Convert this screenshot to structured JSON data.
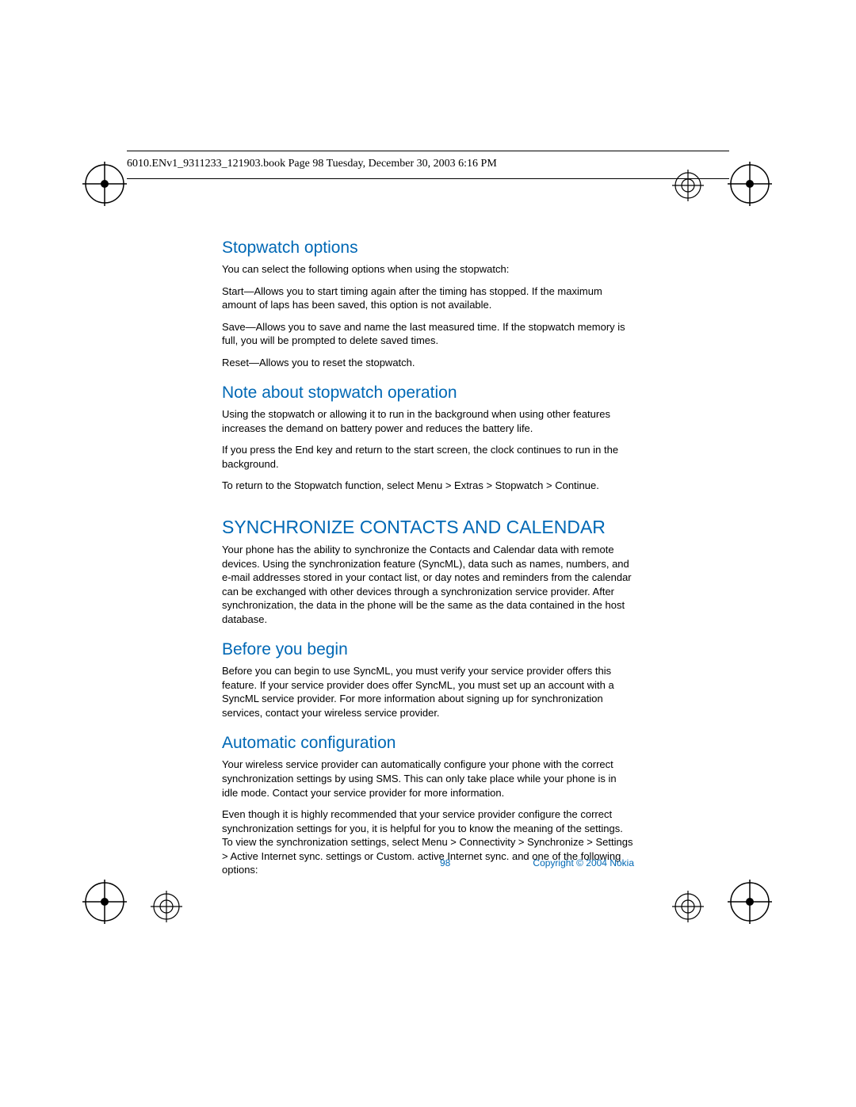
{
  "header": {
    "line": "6010.ENv1_9311233_121903.book  Page 98  Tuesday, December 30, 2003  6:16 PM"
  },
  "sections": {
    "stopwatch_options": {
      "title": "Stopwatch options",
      "intro": "You can select the following options when using the stopwatch:",
      "start": "Start—Allows you to start timing again after the timing has stopped. If the maximum amount of laps has been saved, this option is not available.",
      "save": "Save—Allows you to save and name the last measured time. If the stopwatch memory is full, you will be prompted to delete saved times.",
      "reset": "Reset—Allows you to reset the stopwatch."
    },
    "note": {
      "title": "Note about stopwatch operation",
      "p1": "Using the stopwatch or allowing it to run in the background when using other features increases the demand on battery power and reduces the battery life.",
      "p2": "If you press the End key and return to the start screen, the clock continues to run in the background.",
      "p3": "To return to the Stopwatch function, select Menu > Extras > Stopwatch > Continue."
    },
    "sync": {
      "title": "SYNCHRONIZE CONTACTS AND CALENDAR",
      "p1": "Your phone has the ability to synchronize the Contacts and Calendar data with remote devices. Using the synchronization feature (SyncML), data such as names, numbers, and e-mail addresses stored in your contact list, or day notes and reminders from the calendar can be exchanged with other devices through a synchronization service provider. After synchronization, the data in the phone will be the same as the data contained in the host database."
    },
    "before": {
      "title": "Before you begin",
      "p1": "Before you can begin to use SyncML, you must verify your service provider offers this feature. If your service provider does offer SyncML, you must set up an account with a SyncML service provider. For more information about signing up for synchronization services, contact your wireless service provider."
    },
    "auto": {
      "title": "Automatic configuration",
      "p1": "Your wireless service provider can automatically configure your phone with the correct synchronization settings by using SMS. This can only take place while your phone is in idle mode. Contact your service provider for more information.",
      "p2": "Even though it is highly recommended that your service provider configure the correct synchronization settings for you, it is helpful for you to know the meaning of the settings. To view the synchronization settings, select Menu > Connectivity > Synchronize > Settings > Active Internet sync. settings or Custom. active Internet sync. and one of the following options:"
    }
  },
  "footer": {
    "page": "98",
    "copyright": "Copyright © 2004 Nokia"
  }
}
